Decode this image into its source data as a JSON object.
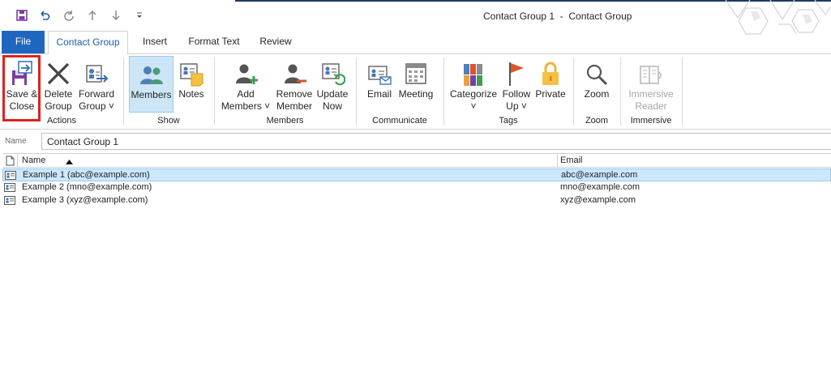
{
  "window": {
    "title": "Contact Group 1  -  Contact Group"
  },
  "quick_access": [
    {
      "name": "save-icon"
    },
    {
      "name": "undo-icon"
    },
    {
      "name": "redo-icon"
    },
    {
      "name": "arrow-up-icon"
    },
    {
      "name": "arrow-down-icon"
    },
    {
      "name": "customize-icon"
    }
  ],
  "tabs": {
    "file": "File",
    "contact_group": "Contact Group",
    "insert": "Insert",
    "format_text": "Format Text",
    "review": "Review"
  },
  "ribbon": {
    "actions": {
      "label": "Actions",
      "save_close": [
        "Save &",
        "Close"
      ],
      "delete_group": [
        "Delete",
        "Group"
      ],
      "forward_group": [
        "Forward",
        "Group ˅"
      ]
    },
    "show": {
      "label": "Show",
      "members": "Members",
      "notes": "Notes"
    },
    "members": {
      "label": "Members",
      "add_members": [
        "Add",
        "Members ˅"
      ],
      "remove_member": [
        "Remove",
        "Member"
      ],
      "update_now": [
        "Update",
        "Now"
      ]
    },
    "communicate": {
      "label": "Communicate",
      "email": "Email",
      "meeting": "Meeting"
    },
    "tags": {
      "label": "Tags",
      "categorize": [
        "Categorize",
        "˅"
      ],
      "follow_up": [
        "Follow",
        "Up ˅"
      ],
      "private": "Private"
    },
    "zoom": {
      "label": "Zoom",
      "zoom": "Zoom"
    },
    "immersive": {
      "label": "Immersive",
      "immersive_reader": [
        "Immersive",
        "Reader"
      ]
    }
  },
  "name_field": {
    "label": "Name",
    "value": "Contact Group 1"
  },
  "list": {
    "columns": {
      "name": "Name",
      "email": "Email"
    },
    "rows": [
      {
        "name": "Example 1 (abc@example.com)",
        "email": "abc@example.com"
      },
      {
        "name": "Example 2 (mno@example.com)",
        "email": "mno@example.com"
      },
      {
        "name": "Example 3 (xyz@example.com)",
        "email": "xyz@example.com"
      }
    ]
  },
  "colors": {
    "accent": "#1e66c0",
    "selection": "#cce8ff",
    "highlight_box": "#e02020",
    "save_icon": "#7a3ea1"
  }
}
